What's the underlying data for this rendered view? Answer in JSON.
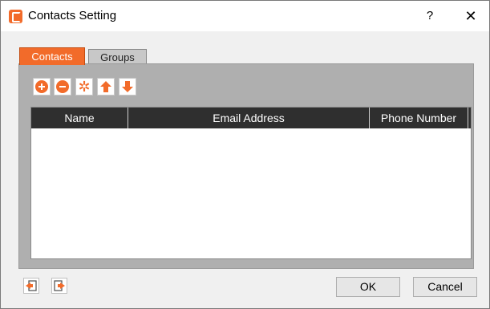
{
  "window": {
    "title": "Contacts Setting",
    "help_label": "?",
    "close_label": "✕",
    "icon": "contacts-app-icon"
  },
  "tabs": [
    {
      "label": "Contacts",
      "active": true
    },
    {
      "label": "Groups",
      "active": false
    }
  ],
  "toolbar": {
    "buttons": [
      "add-icon",
      "remove-icon",
      "settings-gear-icon",
      "move-up-icon",
      "move-down-icon"
    ]
  },
  "table": {
    "columns": [
      "Name",
      "Email Address",
      "Phone Number"
    ],
    "rows": []
  },
  "footer": {
    "left_icons": [
      "import-icon",
      "export-icon"
    ],
    "ok_label": "OK",
    "cancel_label": "Cancel"
  },
  "colors": {
    "accent": "#f26b2a",
    "header_bg": "#2f2f2f",
    "panel_bg": "#afafaf"
  }
}
